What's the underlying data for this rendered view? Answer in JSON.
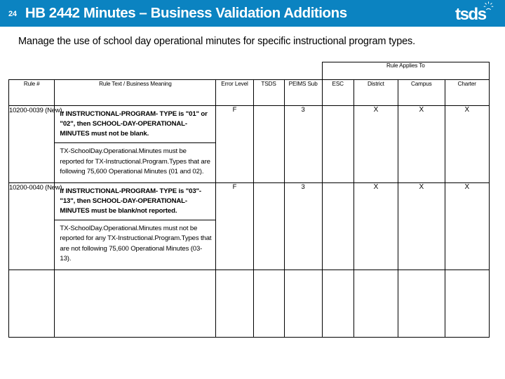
{
  "header": {
    "slide_number": "24",
    "title": "HB 2442 Minutes – Business Validation Additions",
    "brand": "tsds",
    "brand_mark_icon": "sunburst-icon",
    "accent_color": "#0b83c1"
  },
  "subtitle": "Manage the use of school day operational minutes for specific instructional program types.",
  "table": {
    "group_header": "Rule Applies To",
    "columns": [
      "Rule #",
      "Rule Text / Business Meaning",
      "Error Level",
      "TSDS",
      "PEIMS Sub",
      "ESC",
      "District",
      "Campus",
      "Charter"
    ],
    "rows": [
      {
        "rule_number": "10200-0039 (New)",
        "rule_text": "If INSTRUCTIONAL-PROGRAM- TYPE is \"01\" or \"02\", then SCHOOL-DAY-OPERATIONAL-MINUTES must not be blank.",
        "business_meaning": "TX-SchoolDay.Operational.Minutes must be reported for TX-Instructional.Program.Types that are following 75,600 Operational Minutes (01 and 02).",
        "error_level": "F",
        "tsds": "",
        "peims_sub": "3",
        "esc": "",
        "district": "X",
        "campus": "X",
        "charter": "X"
      },
      {
        "rule_number": "10200-0040 (New)",
        "rule_text": "If INSTRUCTIONAL-PROGRAM- TYPE is \"03\"-\"13\", then SCHOOL-DAY-OPERATIONAL-MINUTES must be blank/not reported.",
        "business_meaning": "TX-SchoolDay.Operational.Minutes must not be reported for any TX-Instructional.Program.Types that are not following 75,600 Operational Minutes (03-13).",
        "error_level": "F",
        "tsds": "",
        "peims_sub": "3",
        "esc": "",
        "district": "X",
        "campus": "X",
        "charter": "X"
      }
    ]
  }
}
